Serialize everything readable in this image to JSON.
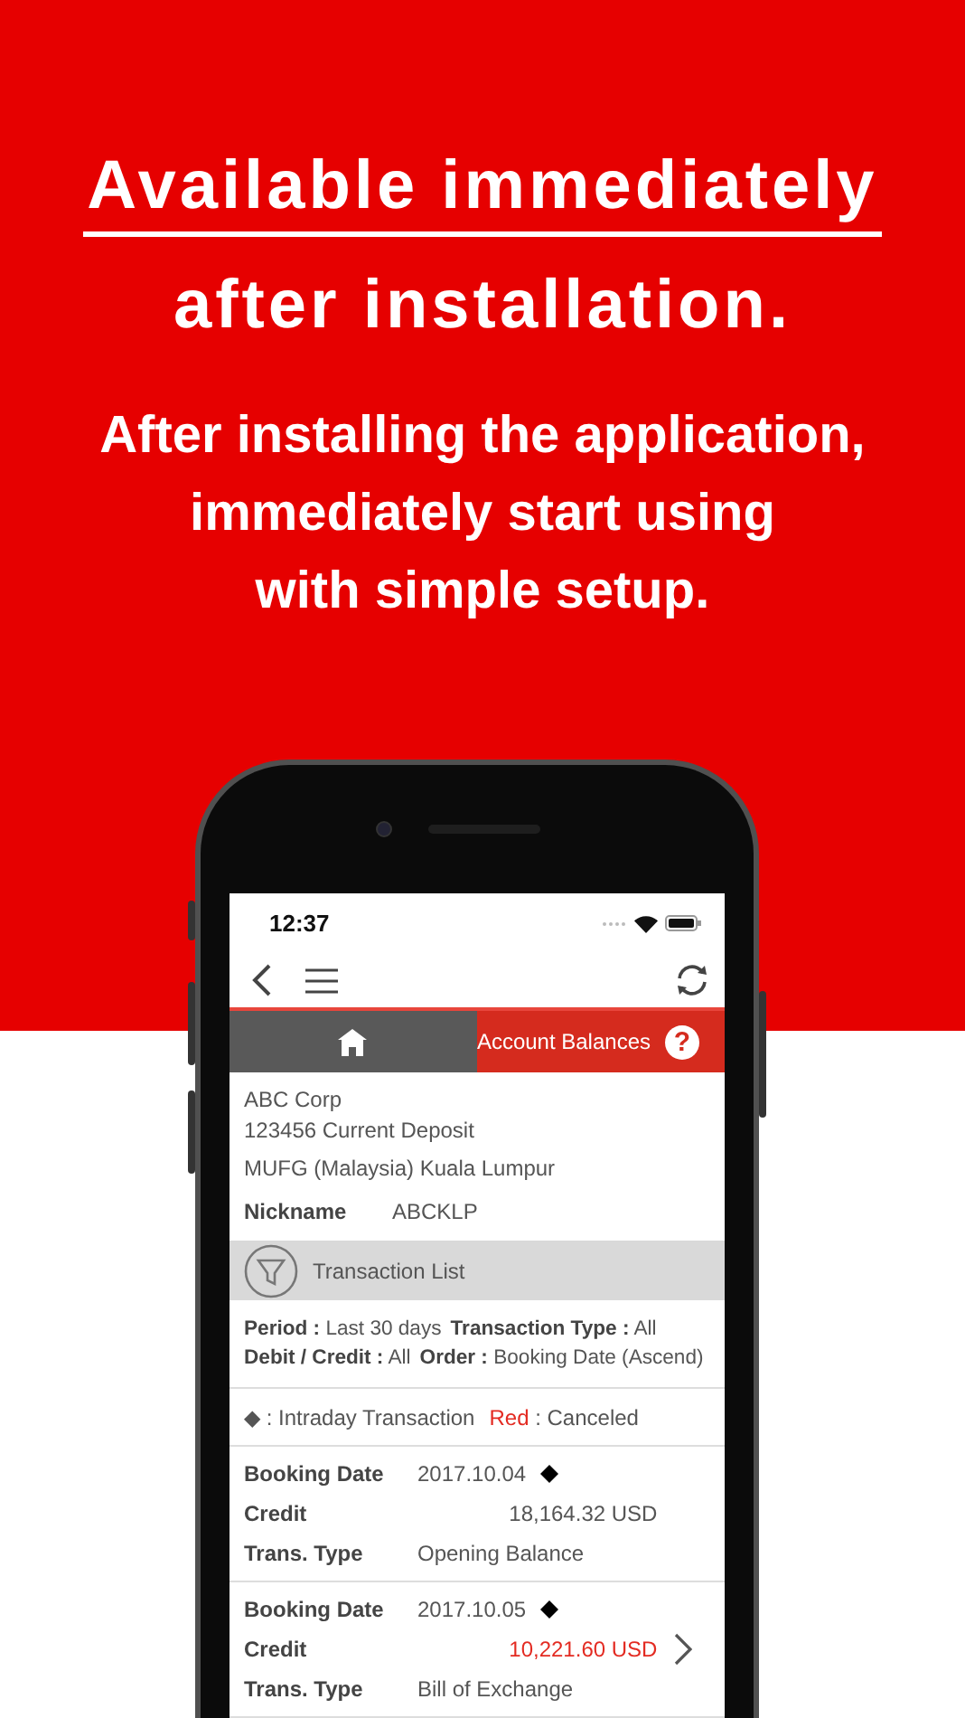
{
  "headline": {
    "title_lines": [
      {
        "text": "Available immediately",
        "underlined": true
      },
      {
        "text": "after installation.",
        "underlined": false
      }
    ],
    "subtitle_lines": [
      "After installing the application,",
      "immediately start using",
      "with simple setup."
    ]
  },
  "phone": {
    "status_bar": {
      "time": "12:37"
    },
    "header": {
      "title": "Account Balances",
      "help_glyph": "?"
    },
    "account": {
      "name": "ABC Corp",
      "number": "123456 Current Deposit",
      "branch": "MUFG (Malaysia) Kuala Lumpur",
      "nickname_label": "Nickname",
      "nickname": "ABCKLP"
    },
    "transaction_list": {
      "title": "Transaction List"
    },
    "filters": [
      [
        "**Period :** Last 30 days",
        "**Transaction Type :** All"
      ],
      [
        "**Debit / Credit :** All",
        "**Order :** Booking Date (Ascend)"
      ]
    ],
    "legend": [
      {
        "kind": "symbol",
        "key": "◆",
        "text": ": Intraday Transaction"
      },
      {
        "kind": "color",
        "key": "Red",
        "color": "#e32b22",
        "text": ": Canceled"
      }
    ],
    "transactions": [
      {
        "date_label": "Booking Date",
        "date": "2017.10.04",
        "intraday": true,
        "amount_label": "Credit",
        "amount": "18,164.32 USD",
        "canceled": false,
        "has_detail": false,
        "type_label": "Trans. Type",
        "type": "Opening Balance"
      },
      {
        "date_label": "Booking Date",
        "date": "2017.10.05",
        "intraday": true,
        "amount_label": "Credit",
        "amount": "10,221.60 USD",
        "canceled": true,
        "has_detail": true,
        "type_label": "Trans. Type",
        "type": "Bill of Exchange"
      }
    ]
  }
}
